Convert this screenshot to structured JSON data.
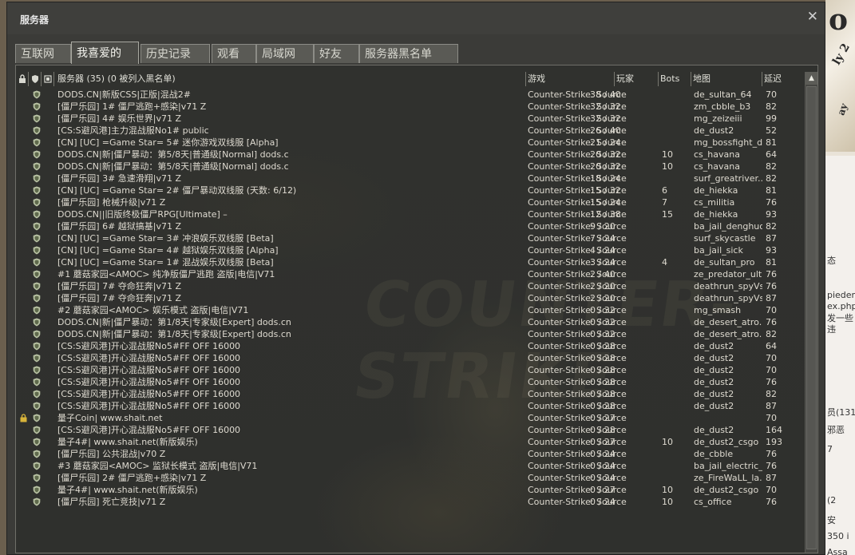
{
  "window": {
    "title": "服务器",
    "close_icon": "close-icon"
  },
  "tabs": [
    {
      "label": "互联网",
      "active": false
    },
    {
      "label": "我喜爱的",
      "active": true
    },
    {
      "label": "历史记录",
      "active": false
    },
    {
      "label": "观看",
      "active": false
    },
    {
      "label": "局域网",
      "active": false
    },
    {
      "label": "好友",
      "active": false
    },
    {
      "label": "服务器黑名单",
      "active": false
    }
  ],
  "header": {
    "lock_icon": "lock-icon",
    "vac_icon": "vac-shield-icon",
    "replay_icon": "replay-icon",
    "servers": "服务器 (35) (0 被列入黑名单)",
    "game": "游戏",
    "players": "玩家",
    "bots": "Bots",
    "map": "地图",
    "latency": "延迟"
  },
  "colors": {
    "text": "#dedad0",
    "panel": "#2e2f2d",
    "shield": "#b9c3a4",
    "lock": "#d8b43a"
  },
  "servers": [
    {
      "locked": false,
      "name": "DODS.CN|新版CSS|正版|混战2#",
      "game": "Counter-Strike: Source",
      "players": "38 / 40",
      "bots": "",
      "map": "de_sultan_64",
      "latency": "70"
    },
    {
      "locked": false,
      "name": "[僵尸乐园] 1# 僵尸逃跑+感染|v71 Z",
      "game": "Counter-Strike: Source",
      "players": "32 / 32",
      "bots": "",
      "map": "zm_cbble_b3",
      "latency": "82"
    },
    {
      "locked": false,
      "name": "[僵尸乐园] 4# 娱乐世界|v71 Z",
      "game": "Counter-Strike: Source",
      "players": "32 / 32",
      "bots": "",
      "map": "mg_zeizeiii",
      "latency": "99"
    },
    {
      "locked": false,
      "name": "[CS:S避风港]主力混战服No1# public",
      "game": "Counter-Strike: Source",
      "players": "26 / 40",
      "bots": "",
      "map": "de_dust2",
      "latency": "52"
    },
    {
      "locked": false,
      "name": "[CN] [UC] =Game Star= 5# 迷你游戏双线服 [Alpha]",
      "game": "Counter-Strike: Source",
      "players": "21 / 24",
      "bots": "",
      "map": "mg_bossfight_dr...",
      "latency": "81"
    },
    {
      "locked": false,
      "name": "DODS.CN|新|僵尸暴动：第5/8天|普通级[Normal]   dods.c",
      "game": "Counter-Strike: Source",
      "players": "20 / 32",
      "bots": "10",
      "map": "cs_havana",
      "latency": "64"
    },
    {
      "locked": false,
      "name": "DODS.CN|新|僵尸暴动：第5/8天|普通级[Normal]   dods.c",
      "game": "Counter-Strike: Source",
      "players": "20 / 32",
      "bots": "10",
      "map": "cs_havana",
      "latency": "82"
    },
    {
      "locked": false,
      "name": "[僵尸乐园] 3# 急速滑翔|v71 Z",
      "game": "Counter-Strike: Source",
      "players": "18 / 24",
      "bots": "",
      "map": "surf_greatriver...",
      "latency": "82"
    },
    {
      "locked": false,
      "name": "[CN] [UC] =Game Star= 2# 僵尸暴动双线服 (天数: 6/12)",
      "game": "Counter-Strike: Source",
      "players": "15 / 32",
      "bots": "6",
      "map": "de_hiekka",
      "latency": "81"
    },
    {
      "locked": false,
      "name": "[僵尸乐园] 枪械升级|v71 Z",
      "game": "Counter-Strike: Source",
      "players": "15 / 24",
      "bots": "7",
      "map": "cs_militia",
      "latency": "76"
    },
    {
      "locked": false,
      "name": "DODS.CN||旧版终极僵尸RPG[Ultimate] –",
      "game": "Counter-Strike: Source",
      "players": "12 / 38",
      "bots": "15",
      "map": "de_hiekka",
      "latency": "93"
    },
    {
      "locked": false,
      "name": "[僵尸乐园] 6# 越狱搞基|v71 Z",
      "game": "Counter-Strike: Source",
      "players": "9 / 20",
      "bots": "",
      "map": "ba_jail_denghuo...",
      "latency": "82"
    },
    {
      "locked": false,
      "name": "[CN] [UC] =Game Star= 3# 冲浪娱乐双线服 [Beta]",
      "game": "Counter-Strike: Source",
      "players": "7 / 24",
      "bots": "",
      "map": "surf_skycastle",
      "latency": "87"
    },
    {
      "locked": false,
      "name": "[CN] [UC] =Game Star= 4# 越狱娱乐双线服 [Alpha]",
      "game": "Counter-Strike: Source",
      "players": "4 / 24",
      "bots": "",
      "map": "ba_jail_sick",
      "latency": "93"
    },
    {
      "locked": false,
      "name": "[CN] [UC] =Game Star= 1# 混战娱乐双线服 [Beta]",
      "game": "Counter-Strike: Source",
      "players": "3 / 24",
      "bots": "4",
      "map": "de_sultan_pro",
      "latency": "81"
    },
    {
      "locked": false,
      "name": "#1 蘑菇家园<AMOC> 纯净版僵尸逃跑 盗版|电信|V71",
      "game": "Counter-Strike: Source",
      "players": "2 / 40",
      "bots": "",
      "map": "ze_predator_ult...",
      "latency": "76"
    },
    {
      "locked": false,
      "name": "[僵尸乐园] 7# 夺命狂奔|v71 Z",
      "game": "Counter-Strike: Source",
      "players": "2 / 20",
      "bots": "",
      "map": "deathrun_spyVs...",
      "latency": "76"
    },
    {
      "locked": false,
      "name": "[僵尸乐园] 7# 夺命狂奔|v71 Z",
      "game": "Counter-Strike: Source",
      "players": "2 / 20",
      "bots": "",
      "map": "deathrun_spyVs...",
      "latency": "87"
    },
    {
      "locked": false,
      "name": "#2 蘑菇家园<AMOC> 娱乐模式 盗版|电信|V71",
      "game": "Counter-Strike: Source",
      "players": "0 / 32",
      "bots": "",
      "map": "mg_smash",
      "latency": "70"
    },
    {
      "locked": false,
      "name": "DODS.CN|新|僵尸暴动：第1/8天|专家级[Expert]  dods.cn",
      "game": "Counter-Strike: Source",
      "players": "0 / 32",
      "bots": "",
      "map": "de_desert_atro...",
      "latency": "76"
    },
    {
      "locked": false,
      "name": "DODS.CN|新|僵尸暴动：第1/8天|专家级[Expert]  dods.cn",
      "game": "Counter-Strike: Source",
      "players": "0 / 32",
      "bots": "",
      "map": "de_desert_atro...",
      "latency": "82"
    },
    {
      "locked": false,
      "name": "[CS:S避风港]开心混战服No5#FF OFF 16000",
      "game": "Counter-Strike: Source",
      "players": "0 / 28",
      "bots": "",
      "map": "de_dust2",
      "latency": "64"
    },
    {
      "locked": false,
      "name": "[CS:S避风港]开心混战服No5#FF OFF 16000",
      "game": "Counter-Strike: Source",
      "players": "0 / 28",
      "bots": "",
      "map": "de_dust2",
      "latency": "70"
    },
    {
      "locked": false,
      "name": "[CS:S避风港]开心混战服No5#FF OFF 16000",
      "game": "Counter-Strike: Source",
      "players": "0 / 28",
      "bots": "",
      "map": "de_dust2",
      "latency": "70"
    },
    {
      "locked": false,
      "name": "[CS:S避风港]开心混战服No5#FF OFF 16000",
      "game": "Counter-Strike: Source",
      "players": "0 / 28",
      "bots": "",
      "map": "de_dust2",
      "latency": "76"
    },
    {
      "locked": false,
      "name": "[CS:S避风港]开心混战服No5#FF OFF 16000",
      "game": "Counter-Strike: Source",
      "players": "0 / 28",
      "bots": "",
      "map": "de_dust2",
      "latency": "82"
    },
    {
      "locked": false,
      "name": "[CS:S避风港]开心混战服No5#FF OFF 16000",
      "game": "Counter-Strike: Source",
      "players": "0 / 28",
      "bots": "",
      "map": "de_dust2",
      "latency": "87"
    },
    {
      "locked": true,
      "name": "量子Coin| www.shait.net",
      "game": "Counter-Strike: Source",
      "players": "0 / 27",
      "bots": "",
      "map": "",
      "latency": "70"
    },
    {
      "locked": false,
      "name": "[CS:S避风港]开心混战服No5#FF OFF 16000",
      "game": "Counter-Strike: Source",
      "players": "0 / 28",
      "bots": "",
      "map": "de_dust2",
      "latency": "164"
    },
    {
      "locked": false,
      "name": "量子4#| www.shait.net(新版娱乐)",
      "game": "Counter-Strike: Source",
      "players": "0 / 27",
      "bots": "10",
      "map": "de_dust2_csgo",
      "latency": "193"
    },
    {
      "locked": false,
      "name": "[僵尸乐园] 公共混战|v70 Z",
      "game": "Counter-Strike: Source",
      "players": "0 / 24",
      "bots": "",
      "map": "de_cbble",
      "latency": "76"
    },
    {
      "locked": false,
      "name": "#3 蘑菇家园<AMOC> 监狱长模式 盗版|电信|V71",
      "game": "Counter-Strike: Source",
      "players": "0 / 24",
      "bots": "",
      "map": "ba_jail_electric_l...",
      "latency": "76"
    },
    {
      "locked": false,
      "name": "[僵尸乐园] 2# 僵尸逃跑+感染|v71 Z",
      "game": "Counter-Strike: Source",
      "players": "0 / 24",
      "bots": "",
      "map": "ze_FireWaLL_la...",
      "latency": "87"
    },
    {
      "locked": false,
      "name": "量子4#| www.shait.net(新版娱乐)",
      "game": "Counter-Strike: Source",
      "players": "0 / 27",
      "bots": "10",
      "map": "de_dust2_csgo",
      "latency": "70"
    },
    {
      "locked": false,
      "name": "[僵尸乐园] 死亡竞技|v71 Z",
      "game": "Counter-Strike: Source",
      "players": "0 / 24",
      "bots": "10",
      "map": "cs_office",
      "latency": "76"
    }
  ],
  "background_right": {
    "lines": [
      "态",
      "pieden",
      "ex.php",
      "发一些",
      "违",
      "员(131",
      "邪恶",
      "7",
      "(2",
      "安",
      "350 i",
      "Assa"
    ]
  }
}
